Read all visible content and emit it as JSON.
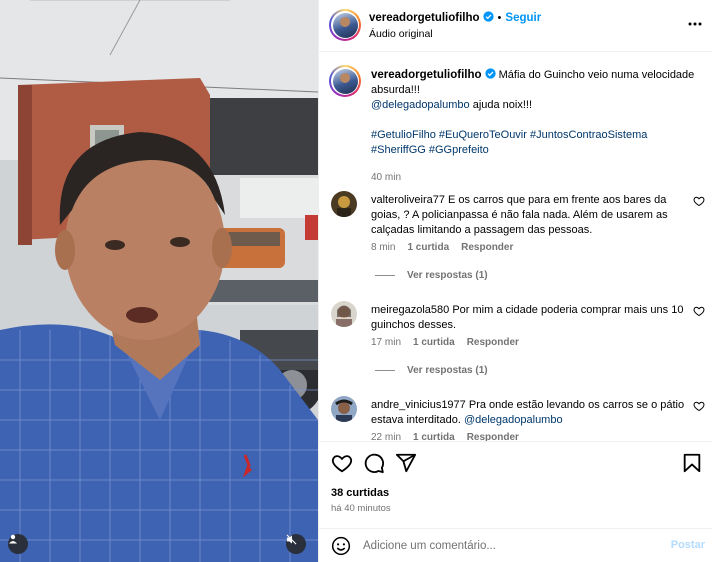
{
  "header": {
    "username": "vereadorgetuliofilho",
    "separator": "•",
    "follow_label": "Seguir",
    "audio_label": "Áudio original",
    "more_icon": "more-horizontal-icon"
  },
  "caption": {
    "username": "vereadorgetuliofilho",
    "line1": "Máfia do Guincho veio numa velocidade absurda!!!",
    "mention": "@delegadopalumbo",
    "line2_rest": " ajuda noix!!!",
    "hashtags_line1": "#GetulioFilho #EuQueroTeOuvir #JuntosContraoSistema",
    "hashtags_line2": "#SheriffGG #GGprefeito",
    "time": "40 min"
  },
  "comments": [
    {
      "username": "valteroliveira77",
      "text": " E os carros que para em frente aos bares da goias, ? A policianpassa é não fala nada. Além de usarem as calçadas limitando a passagem das pessoas.",
      "time": "8 min",
      "likes": "1 curtida",
      "reply_label": "Responder",
      "view_replies": "Ver respostas (1)"
    },
    {
      "username": "meiregazola580",
      "text": " Por mim a cidade poderia comprar mais uns 10 guinchos desses.",
      "time": "17 min",
      "likes": "1 curtida",
      "reply_label": "Responder",
      "view_replies": "Ver respostas (1)"
    },
    {
      "username": "andre_vinicius1977",
      "text": " Pra onde estão levando os carros se o pátio estava interditado. ",
      "mention": "@delegadopalumbo",
      "time": "22 min",
      "likes": "1 curtida",
      "reply_label": "Responder"
    }
  ],
  "actions": {
    "likes": "38 curtidas",
    "posted": "há 40 minutos"
  },
  "composer": {
    "placeholder": "Adicione um comentário...",
    "post_label": "Postar"
  },
  "colors": {
    "accent_blue": "#0095f6",
    "link_blue": "#00376b",
    "muted": "#737373",
    "post_disabled": "#b3dbff"
  }
}
